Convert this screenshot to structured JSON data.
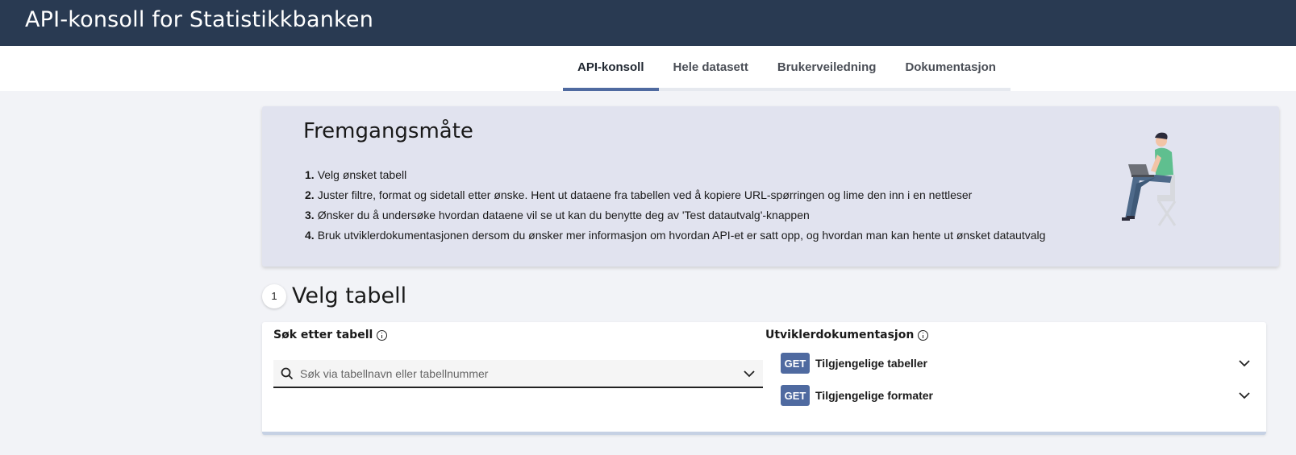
{
  "header": {
    "title": "API-konsoll for Statistikkbanken"
  },
  "nav": {
    "tabs": [
      {
        "label": "API-konsoll",
        "active": true
      },
      {
        "label": "Hele datasett",
        "active": false
      },
      {
        "label": "Brukerveiledning",
        "active": false
      },
      {
        "label": "Dokumentasjon",
        "active": false
      }
    ]
  },
  "howto": {
    "title": "Fremgangsmåte",
    "steps": [
      {
        "num": "1.",
        "text": "Velg ønsket tabell"
      },
      {
        "num": "2.",
        "text": "Juster filtre, format og sidetall etter ønske. Hent ut dataene fra tabellen ved å kopiere URL-spørringen og lime den inn i en nettleser"
      },
      {
        "num": "3.",
        "text": "Ønsker du å undersøke hvordan dataene vil se ut kan du benytte deg av 'Test datautvalg'-knappen"
      },
      {
        "num": "4.",
        "text": "Bruk utviklerdokumentasjonen dersom du ønsker mer informasjon om hvordan API-et er satt opp, og hvordan man kan hente ut ønsket datautvalg"
      }
    ],
    "illustration_icon": "person-with-laptop-illustration"
  },
  "section": {
    "number": "1",
    "title": "Velg tabell"
  },
  "search": {
    "label": "Søk etter tabell",
    "placeholder": "Søk via tabellnavn eller tabellnummer",
    "value": ""
  },
  "devdocs": {
    "label": "Utviklerdokumentasjon",
    "endpoints": [
      {
        "method": "GET",
        "label": "Tilgjengelige tabeller"
      },
      {
        "method": "GET",
        "label": "Tilgjengelige formater"
      }
    ]
  },
  "colors": {
    "header_bg": "#293a52",
    "accent": "#4f6aa0",
    "howto_bg": "#e1e3ef",
    "page_bg": "#f2f3f7"
  }
}
